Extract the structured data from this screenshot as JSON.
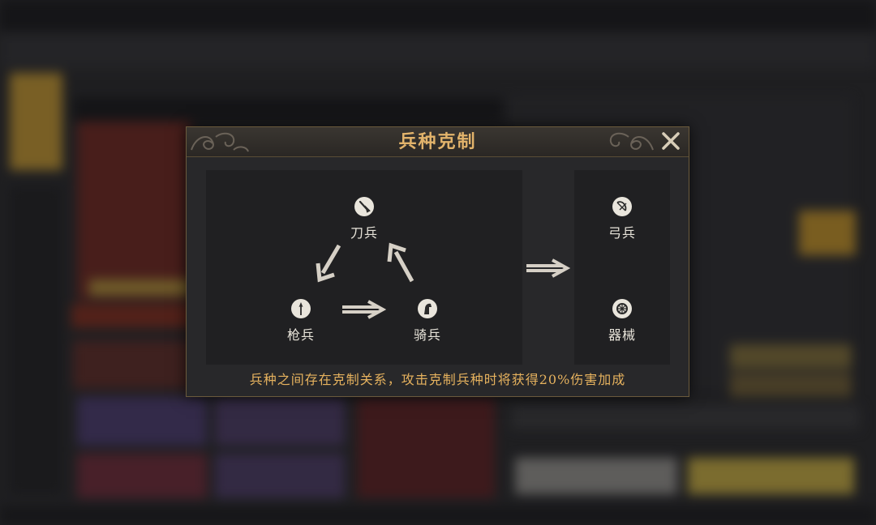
{
  "dialog": {
    "title": "兵种克制",
    "close_icon": "close-icon",
    "footer_text": "兵种之间存在克制关系，攻击克制兵种时将获得20%伤害加成",
    "colors": {
      "title": "#e2b36b",
      "footer": "#e6b25e",
      "label": "#e8e4da",
      "border": "#6b5a3c"
    }
  },
  "units": {
    "blade": {
      "label": "刀兵",
      "icon": "sword-icon"
    },
    "spear": {
      "label": "枪兵",
      "icon": "spear-icon"
    },
    "cavalry": {
      "label": "骑兵",
      "icon": "horse-icon"
    },
    "archer": {
      "label": "弓兵",
      "icon": "bow-icon"
    },
    "siege": {
      "label": "器械",
      "icon": "wheel-icon"
    }
  }
}
